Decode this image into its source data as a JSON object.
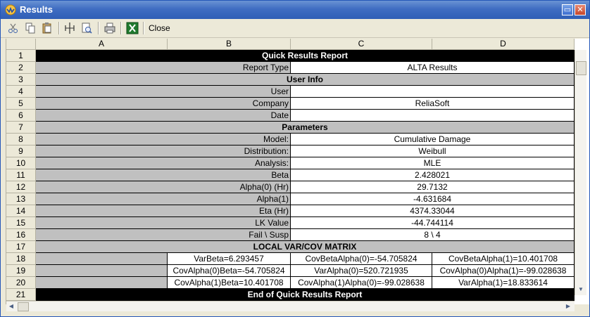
{
  "window": {
    "title": "Results"
  },
  "toolbar": {
    "close_label": "Close"
  },
  "columns": [
    "A",
    "B",
    "C",
    "D"
  ],
  "rows": [
    {
      "num": "1",
      "type": "black",
      "text": "Quick Results Report"
    },
    {
      "num": "2",
      "type": "kv",
      "label": "Report Type",
      "value": "ALTA Results"
    },
    {
      "num": "3",
      "type": "grey",
      "text": "User Info"
    },
    {
      "num": "4",
      "type": "kv",
      "label": "User",
      "value": ""
    },
    {
      "num": "5",
      "type": "kv",
      "label": "Company",
      "value": "ReliaSoft"
    },
    {
      "num": "6",
      "type": "kv",
      "label": "Date",
      "value": ""
    },
    {
      "num": "7",
      "type": "grey",
      "text": "Parameters"
    },
    {
      "num": "8",
      "type": "kv",
      "label": "Model:",
      "value": "Cumulative Damage"
    },
    {
      "num": "9",
      "type": "kv",
      "label": "Distribution:",
      "value": "Weibull"
    },
    {
      "num": "10",
      "type": "kv",
      "label": "Analysis:",
      "value": "MLE"
    },
    {
      "num": "11",
      "type": "kv",
      "label": "Beta",
      "value": "2.428021"
    },
    {
      "num": "12",
      "type": "kv",
      "label": "Alpha(0) (Hr)",
      "value": "29.7132"
    },
    {
      "num": "13",
      "type": "kv",
      "label": "Alpha(1)",
      "value": "-4.631684"
    },
    {
      "num": "14",
      "type": "kv",
      "label": "Eta (Hr)",
      "value": "4374.33044"
    },
    {
      "num": "15",
      "type": "kv",
      "label": "LK Value",
      "value": "-44.744114"
    },
    {
      "num": "16",
      "type": "kv",
      "label": "Fail \\ Susp",
      "value": "8 \\ 4"
    },
    {
      "num": "17",
      "type": "grey",
      "text": "LOCAL VAR/COV MATRIX"
    },
    {
      "num": "18",
      "type": "matrix",
      "cells": [
        "VarBeta=6.293457",
        "CovBetaAlpha(0)=-54.705824",
        "CovBetaAlpha(1)=10.401708"
      ]
    },
    {
      "num": "19",
      "type": "matrix",
      "cells": [
        "CovAlpha(0)Beta=-54.705824",
        "VarAlpha(0)=520.721935",
        "CovAlpha(0)Alpha(1)=-99.028638"
      ]
    },
    {
      "num": "20",
      "type": "matrix",
      "cells": [
        "CovAlpha(1)Beta=10.401708",
        "CovAlpha(1)Alpha(0)=-99.028638",
        "VarAlpha(1)=18.833614"
      ]
    },
    {
      "num": "21",
      "type": "black",
      "text": "End of Quick Results Report"
    }
  ]
}
